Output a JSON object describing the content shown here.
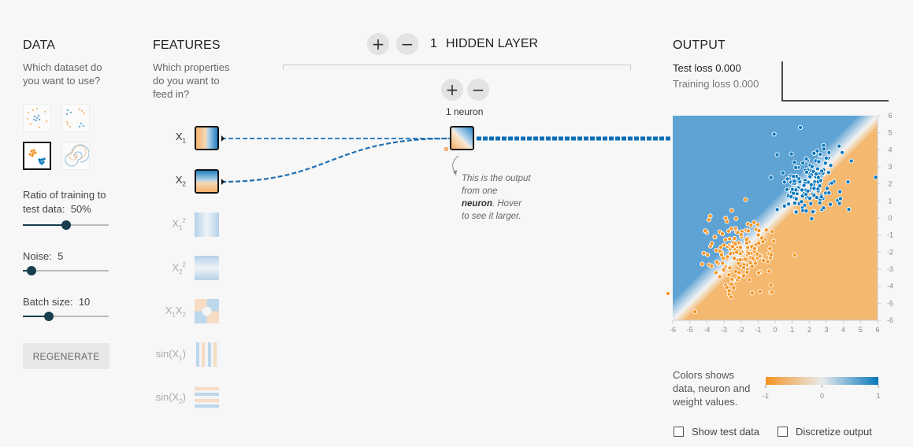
{
  "data_panel": {
    "title": "DATA",
    "subtitle_line1": "Which dataset do",
    "subtitle_line2": "you want to use?",
    "ratio_label": "Ratio of training to",
    "ratio_label2": "test data:",
    "ratio_value": "50%",
    "ratio_fraction": 0.5,
    "noise_label": "Noise:",
    "noise_value": "5",
    "noise_fraction": 0.1,
    "batch_label": "Batch size:",
    "batch_value": "10",
    "batch_fraction": 0.3,
    "regenerate_label": "REGENERATE"
  },
  "features_panel": {
    "title": "FEATURES",
    "subtitle_line1": "Which properties",
    "subtitle_line2": "do you want to",
    "subtitle_line3": "feed in?"
  },
  "network": {
    "layer_count": "1",
    "layer_label": "HIDDEN LAYER",
    "add_symbol": "+",
    "remove_symbol": "−",
    "neuron_count_label": "1 neuron",
    "callout_1": "This is the output",
    "callout_2": "from one",
    "callout_3_bold": "neuron",
    "callout_3_rest": ". Hover",
    "callout_4": "to see it larger."
  },
  "output_panel": {
    "title": "OUTPUT",
    "test_loss_label": "Test loss",
    "test_loss_value": "0.000",
    "training_loss_label": "Training loss",
    "training_loss_value": "0.000",
    "legend_line1": "Colors shows",
    "legend_line2": "data, neuron and",
    "legend_line3": "weight values.",
    "legend_min": "-1",
    "legend_mid": "0",
    "legend_max": "1",
    "show_test_label": "Show test data",
    "discretize_label": "Discretize output"
  },
  "colors": {
    "orange": "#f59322",
    "blue": "#0877bd",
    "dark": "#183d4e"
  },
  "chart_data": {
    "type": "scatter",
    "xlim": [
      -6,
      6
    ],
    "ylim": [
      -6,
      6
    ],
    "x_ticks": [
      -6,
      -5,
      -4,
      -3,
      -2,
      -1,
      0,
      1,
      2,
      3,
      4,
      5,
      6
    ],
    "y_ticks": [
      6,
      5,
      4,
      3,
      2,
      1,
      0,
      -1,
      -2,
      -3,
      -4,
      -5,
      -6
    ],
    "clusters": [
      {
        "class": "blue",
        "center": [
          2,
          2
        ],
        "spread": 1.0,
        "count": 170
      },
      {
        "class": "orange",
        "center": [
          -2,
          -2
        ],
        "spread": 1.0,
        "count": 170
      }
    ]
  }
}
